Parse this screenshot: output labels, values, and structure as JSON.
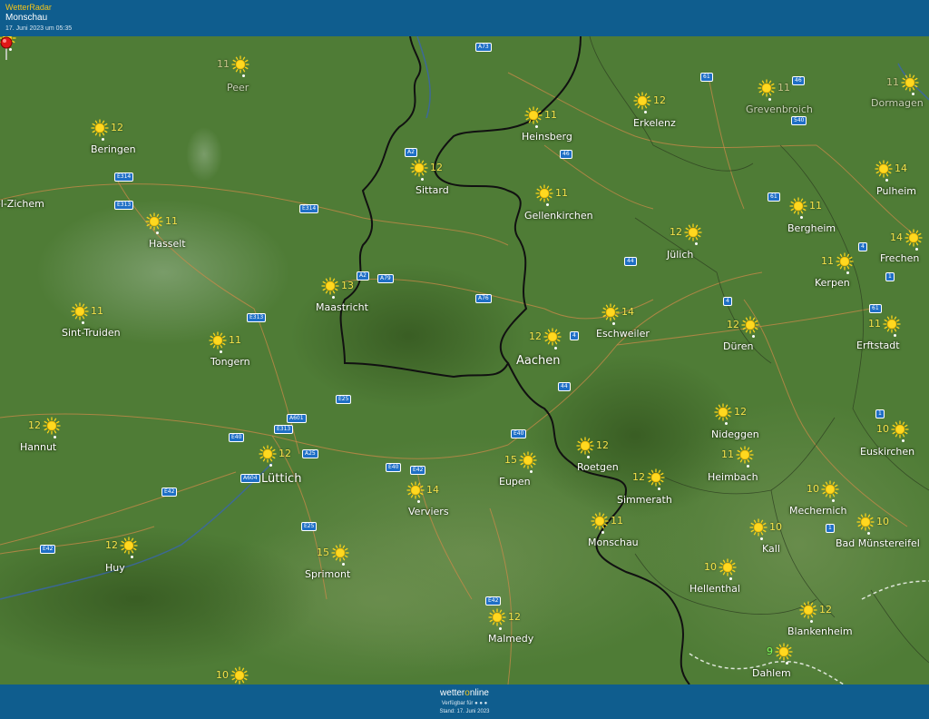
{
  "header": {
    "app_title": "WetterRadar",
    "location": "Monschau",
    "timestamp": "17. Juni 2023 um 05:35"
  },
  "colors": {
    "header_bg": "#0f5d8e",
    "map_bg": "#4d7a35",
    "temp_color": "#f5e14a",
    "border_color": "#111111",
    "road_sign": "#1f6fc6",
    "pin": "#e01818"
  },
  "cities": [
    {
      "name": "Peer",
      "temp": "11",
      "style": "faded"
    },
    {
      "name": "Beringen",
      "temp": "12"
    },
    {
      "name": "el-Zichem",
      "temp": ""
    },
    {
      "name": "Hasselt",
      "temp": "11"
    },
    {
      "name": "Sint-Truiden",
      "temp": "11"
    },
    {
      "name": "Tongern",
      "temp": "11"
    },
    {
      "name": "Maastricht",
      "temp": "13"
    },
    {
      "name": "Sittard",
      "temp": "12"
    },
    {
      "name": "Heinsberg",
      "temp": "11"
    },
    {
      "name": "Erkelenz",
      "temp": "12"
    },
    {
      "name": "Grevenbroich",
      "temp": "11",
      "style": "faded"
    },
    {
      "name": "Dormagen",
      "temp": "11",
      "style": "faded"
    },
    {
      "name": "Gellenkirchen",
      "temp": "11"
    },
    {
      "name": "Jülich",
      "temp": "12"
    },
    {
      "name": "Bergheim",
      "temp": "11"
    },
    {
      "name": "Pulheim",
      "temp": "14"
    },
    {
      "name": "Frechen",
      "temp": "14"
    },
    {
      "name": "Kerpen",
      "temp": "11"
    },
    {
      "name": "Eschweiler",
      "temp": "14"
    },
    {
      "name": "Aachen",
      "temp": "12",
      "style": "big"
    },
    {
      "name": "Düren",
      "temp": "12"
    },
    {
      "name": "Erftstadt",
      "temp": "11"
    },
    {
      "name": "Hannut",
      "temp": "12"
    },
    {
      "name": "Lüttich",
      "temp": "12",
      "style": "big"
    },
    {
      "name": "Roetgen",
      "temp": "12"
    },
    {
      "name": "Nideggen",
      "temp": "12"
    },
    {
      "name": "Euskirchen",
      "temp": "10"
    },
    {
      "name": "Eupen",
      "temp": "15"
    },
    {
      "name": "Verviers",
      "temp": "14"
    },
    {
      "name": "Simmerath",
      "temp": "12"
    },
    {
      "name": "Heimbach",
      "temp": "11"
    },
    {
      "name": "Mechernich",
      "temp": "10"
    },
    {
      "name": "Monschau",
      "temp": "11"
    },
    {
      "name": "Kall",
      "temp": "10"
    },
    {
      "name": "Bad Münstereifel",
      "temp": "10"
    },
    {
      "name": "Huy",
      "temp": "12"
    },
    {
      "name": "Sprimont",
      "temp": "15"
    },
    {
      "name": "Hellenthal",
      "temp": "10"
    },
    {
      "name": "Blankenheim",
      "temp": "12"
    },
    {
      "name": "Malmedy",
      "temp": "12"
    },
    {
      "name": "Dahlem",
      "temp": "9",
      "style": "green"
    },
    {
      "name": "",
      "temp": "10"
    }
  ],
  "roads": [
    "A73",
    "A2",
    "46",
    "61",
    "46",
    "540",
    "E314",
    "E313",
    "E314",
    "A2",
    "A79",
    "A76",
    "44",
    "61",
    "4",
    "1",
    "E313",
    "4",
    "61",
    "4",
    "E25",
    "44",
    "E40",
    "A601",
    "E313",
    "E40",
    "A25",
    "E40",
    "E42",
    "A604",
    "E42",
    "E25",
    "E42",
    "E42",
    "1",
    "1"
  ],
  "footer": {
    "brand_prefix": "wetter",
    "brand_o": "o",
    "brand_suffix": "nline",
    "available": "Verfügbar für ● ● ●",
    "stand": "Stand: 17. Juni 2023"
  }
}
